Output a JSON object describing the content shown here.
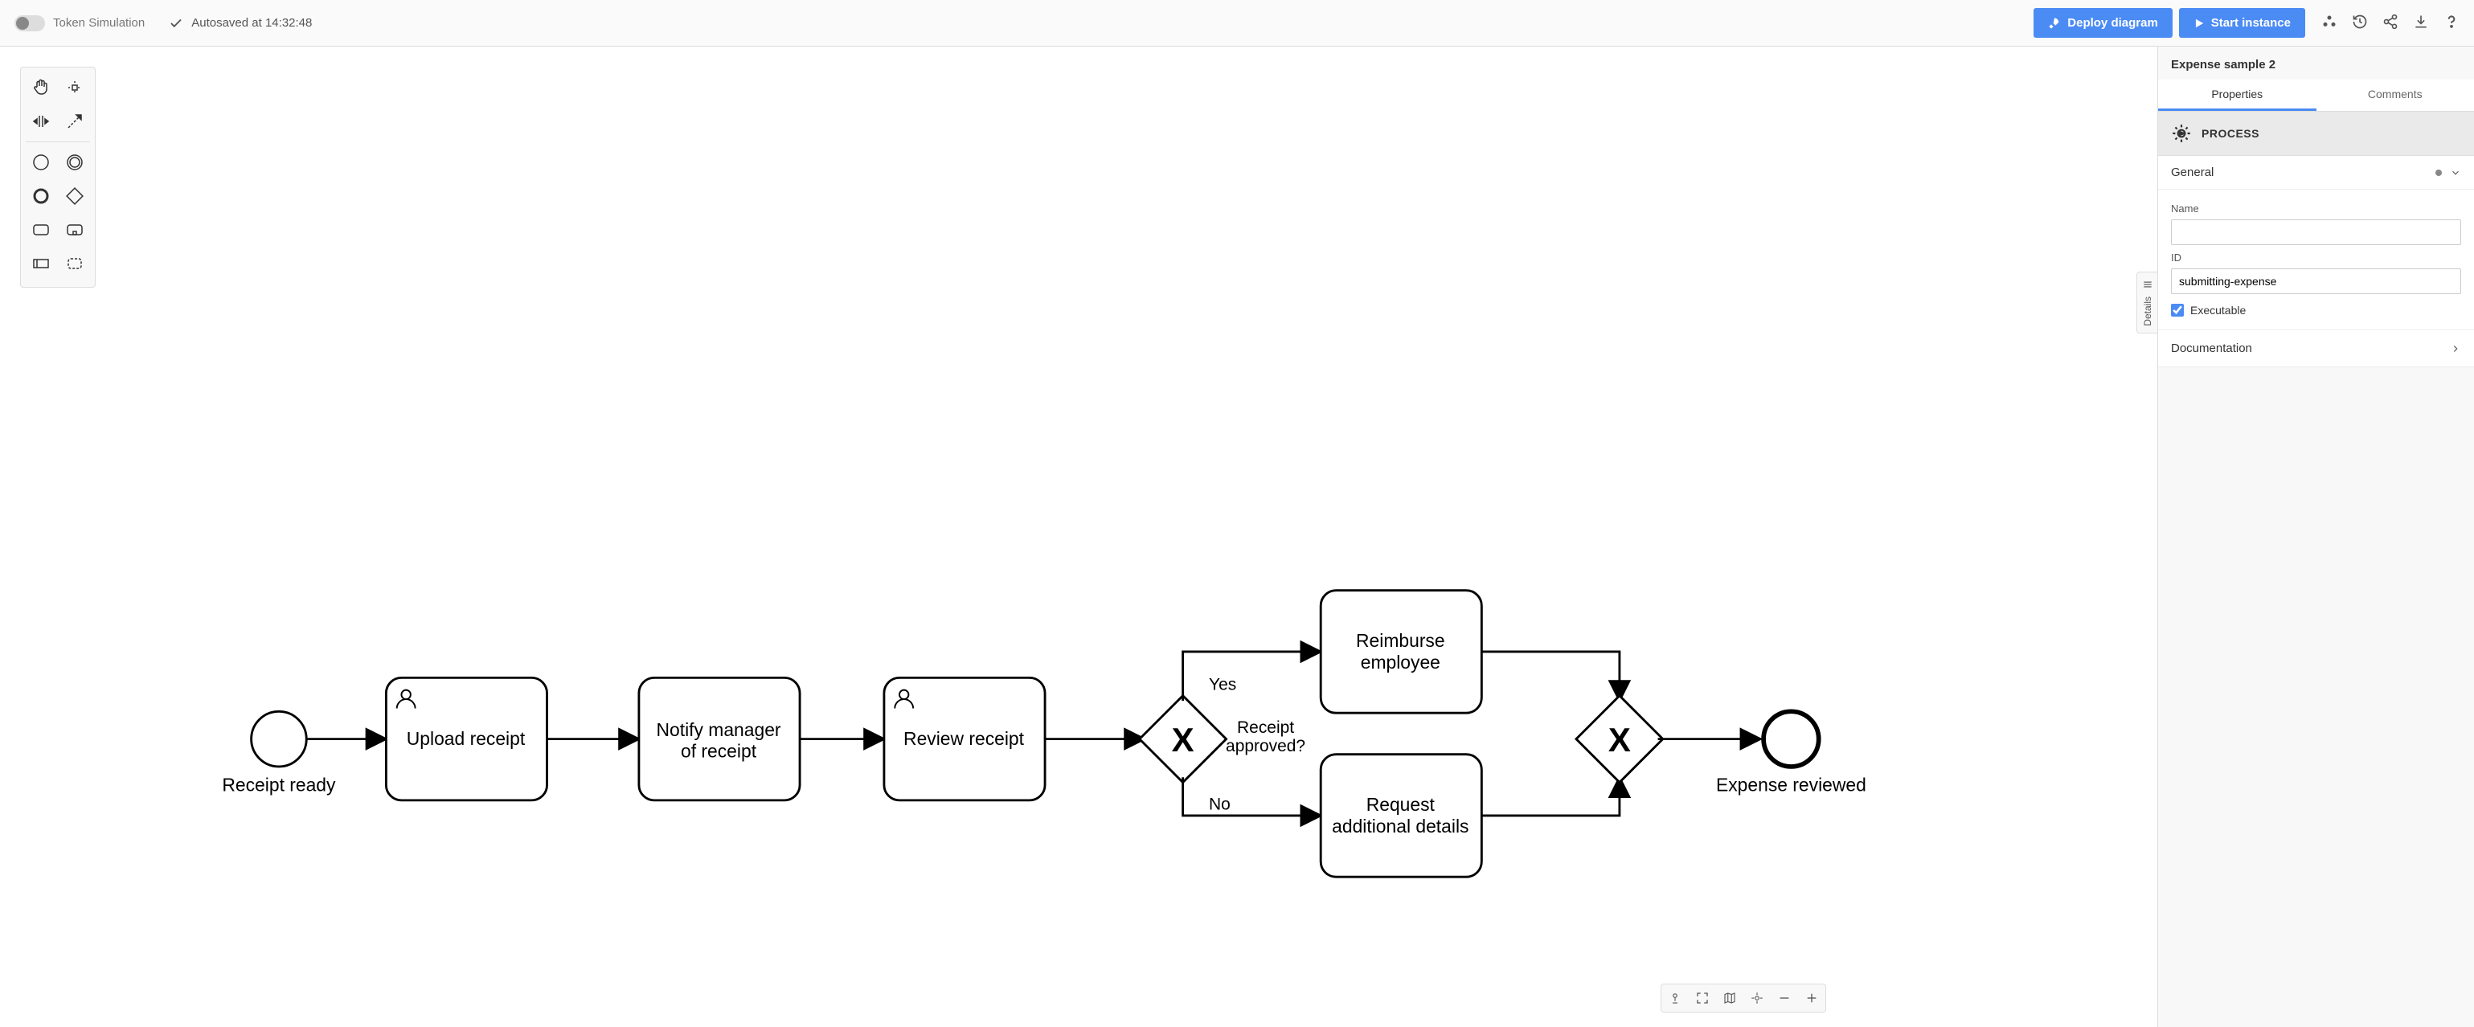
{
  "header": {
    "toggle_label": "Token Simulation",
    "autosave": "Autosaved at 14:32:48",
    "deploy_button": "Deploy diagram",
    "start_button": "Start instance"
  },
  "diagram": {
    "start_label": "Receipt ready",
    "task_upload": "Upload receipt",
    "task_notify_l1": "Notify manager",
    "task_notify_l2": "of receipt",
    "task_review": "Review receipt",
    "gw_label_l1": "Receipt",
    "gw_label_l2": "approved?",
    "flow_yes": "Yes",
    "flow_no": "No",
    "task_reimburse_l1": "Reimburse",
    "task_reimburse_l2": "employee",
    "task_request_l1": "Request",
    "task_request_l2": "additional details",
    "end_label": "Expense reviewed"
  },
  "panel": {
    "title": "Expense sample 2",
    "tab_properties": "Properties",
    "tab_comments": "Comments",
    "section_process": "PROCESS",
    "group_general": "General",
    "field_name_label": "Name",
    "field_name_value": "",
    "field_id_label": "ID",
    "field_id_value": "submitting-expense",
    "executable_label": "Executable",
    "group_documentation": "Documentation"
  },
  "collapse": {
    "label": "Details"
  }
}
